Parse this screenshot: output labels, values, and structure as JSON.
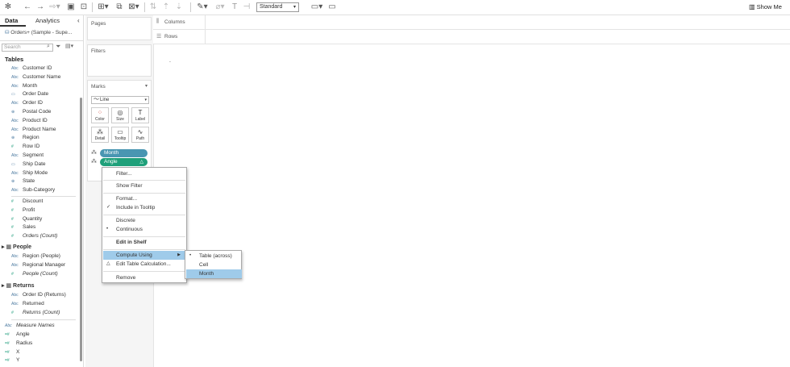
{
  "toolbar": {
    "standard_label": "Standard",
    "show_me_label": "Show Me"
  },
  "data_pane": {
    "tab_data": "Data",
    "tab_analytics": "Analytics",
    "datasource": "Orders+ (Sample - Supe...",
    "search_placeholder": "Search",
    "tables_title": "Tables",
    "orders_fields": [
      {
        "type": "Abc",
        "name": "Customer ID"
      },
      {
        "type": "Abc",
        "name": "Customer Name"
      },
      {
        "type": "Abc",
        "name": "Month"
      },
      {
        "type": "date",
        "name": "Order Date"
      },
      {
        "type": "Abc",
        "name": "Order ID"
      },
      {
        "type": "geo",
        "name": "Postal Code"
      },
      {
        "type": "Abc",
        "name": "Product ID"
      },
      {
        "type": "Abc",
        "name": "Product Name"
      },
      {
        "type": "geo",
        "name": "Region"
      },
      {
        "type": "#",
        "name": "Row ID"
      },
      {
        "type": "Abc",
        "name": "Segment"
      },
      {
        "type": "date",
        "name": "Ship Date"
      },
      {
        "type": "Abc",
        "name": "Ship Mode"
      },
      {
        "type": "geo",
        "name": "State"
      },
      {
        "type": "Abc",
        "name": "Sub-Category"
      }
    ],
    "orders_measures": [
      {
        "type": "#",
        "name": "Discount"
      },
      {
        "type": "#",
        "name": "Profit"
      },
      {
        "type": "#",
        "name": "Quantity"
      },
      {
        "type": "#",
        "name": "Sales"
      },
      {
        "type": "#",
        "name": "Orders (Count)"
      }
    ],
    "people_title": "People",
    "people_fields": [
      {
        "type": "Abc",
        "name": "Region (People)"
      },
      {
        "type": "Abc",
        "name": "Regional Manager"
      },
      {
        "type": "#",
        "name": "People (Count)"
      }
    ],
    "returns_title": "Returns",
    "returns_fields": [
      {
        "type": "Abc",
        "name": "Order ID (Returns)"
      },
      {
        "type": "Abc",
        "name": "Returned"
      },
      {
        "type": "#",
        "name": "Returns (Count)"
      }
    ],
    "measure_names": "Measure Names",
    "calc_fields": [
      {
        "type": "=#",
        "name": "Angle"
      },
      {
        "type": "=#",
        "name": "Radius"
      },
      {
        "type": "=#",
        "name": "X"
      },
      {
        "type": "=#",
        "name": "Y"
      }
    ]
  },
  "shelves": {
    "pages": "Pages",
    "filters": "Filters",
    "marks": "Marks",
    "mark_type": "Line",
    "mark_buttons": [
      "Color",
      "Size",
      "Label",
      "Detail",
      "Tooltip",
      "Path"
    ],
    "pill_month": "Month",
    "pill_angle": "Angle",
    "columns": "Columns",
    "rows": "Rows"
  },
  "canvas": {
    "dot": "."
  },
  "context_menu": {
    "items": [
      "Filter...",
      "Show Filter",
      "Format...",
      "Include in Tooltip",
      "Discrete",
      "Continuous",
      "Edit in Shelf",
      "Compute Using",
      "Edit Table Calculation...",
      "Remove"
    ]
  },
  "submenu": {
    "items": [
      "Table (across)",
      "Cell",
      "Month"
    ]
  },
  "colors": {
    "dimension_pill": "#4996b2",
    "measure_pill": "#1fa07a",
    "highlight": "#9fcbea"
  }
}
